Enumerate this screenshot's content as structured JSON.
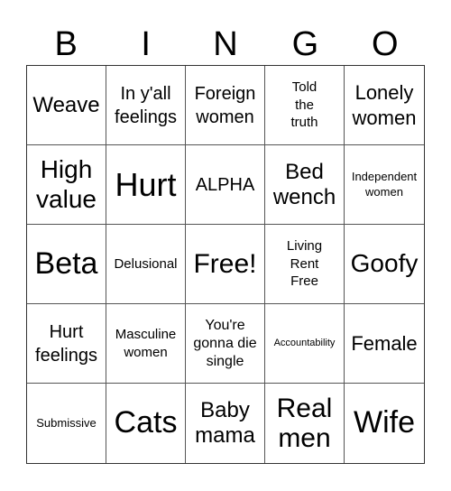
{
  "header": [
    "B",
    "I",
    "N",
    "G",
    "O"
  ],
  "cells": [
    "Weave",
    "In y'all feelings",
    "Foreign women",
    "Told the truth",
    "Lonely women",
    "High value",
    "Hurt",
    "ALPHA",
    "Bed wench",
    "Independent women",
    "Beta",
    "Delusional",
    "Free!",
    "Living Rent Free",
    "Goofy",
    "Hurt feelings",
    "Masculine women",
    "You're gonna die single",
    "Accountability",
    "Female",
    "Submissive",
    "Cats",
    "Baby mama",
    "Real men",
    "Wife"
  ]
}
